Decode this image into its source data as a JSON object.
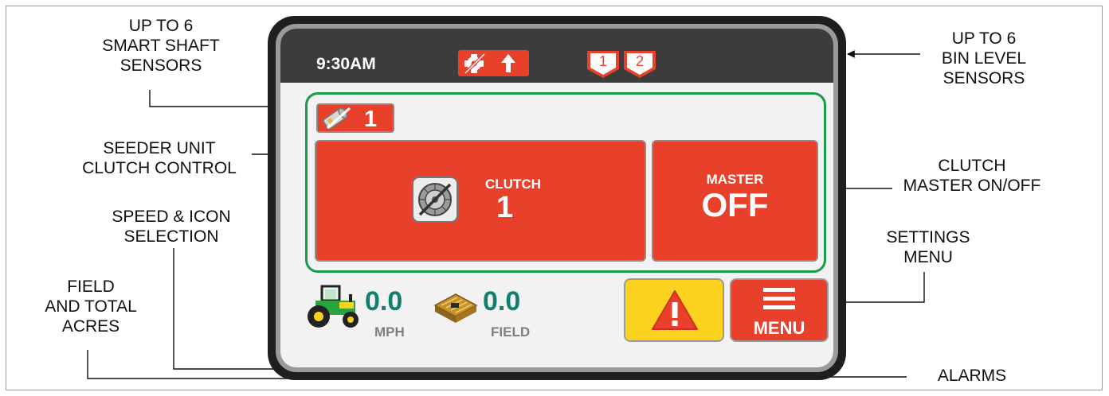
{
  "callouts": {
    "smart_shaft": [
      "UP TO 6",
      "SMART SHAFT",
      "SENSORS"
    ],
    "seeder_clutch": [
      "SEEDER UNIT",
      "CLUTCH CONTROL"
    ],
    "speed_icon": [
      "SPEED & ICON",
      "SELECTION"
    ],
    "field_acres": [
      "FIELD",
      "AND TOTAL",
      "ACRES"
    ],
    "bin_level": [
      "UP TO 6",
      "BIN LEVEL",
      "SENSORS"
    ],
    "clutch_master": [
      "CLUTCH",
      "MASTER ON/OFF"
    ],
    "settings_menu": [
      "SETTINGS",
      "MENU"
    ],
    "alarms": [
      "ALARMS"
    ]
  },
  "screen": {
    "time": "9:30AM",
    "bins": [
      "1",
      "2"
    ],
    "sensor_number": "1",
    "clutch": {
      "label": "CLUTCH",
      "number": "1"
    },
    "master": {
      "label": "MASTER",
      "value": "OFF"
    },
    "speed": {
      "value": "0.0",
      "unit": "MPH"
    },
    "field": {
      "value": "0.0",
      "unit": "FIELD"
    },
    "menu_label": "MENU"
  },
  "colors": {
    "accent_red": "#e8402a",
    "green_outline": "#1a9a4b",
    "readout_teal": "#0f7f6e",
    "alarm_yellow": "#fbd31f",
    "statusbar": "#3c3c3c"
  },
  "icons": [
    "shaft-sensor-off-icon",
    "up-arrow-icon",
    "bin-level-icon",
    "clutch-disengaged-icon",
    "tractor-icon",
    "field-acres-icon",
    "warning-icon",
    "hamburger-menu-icon"
  ]
}
